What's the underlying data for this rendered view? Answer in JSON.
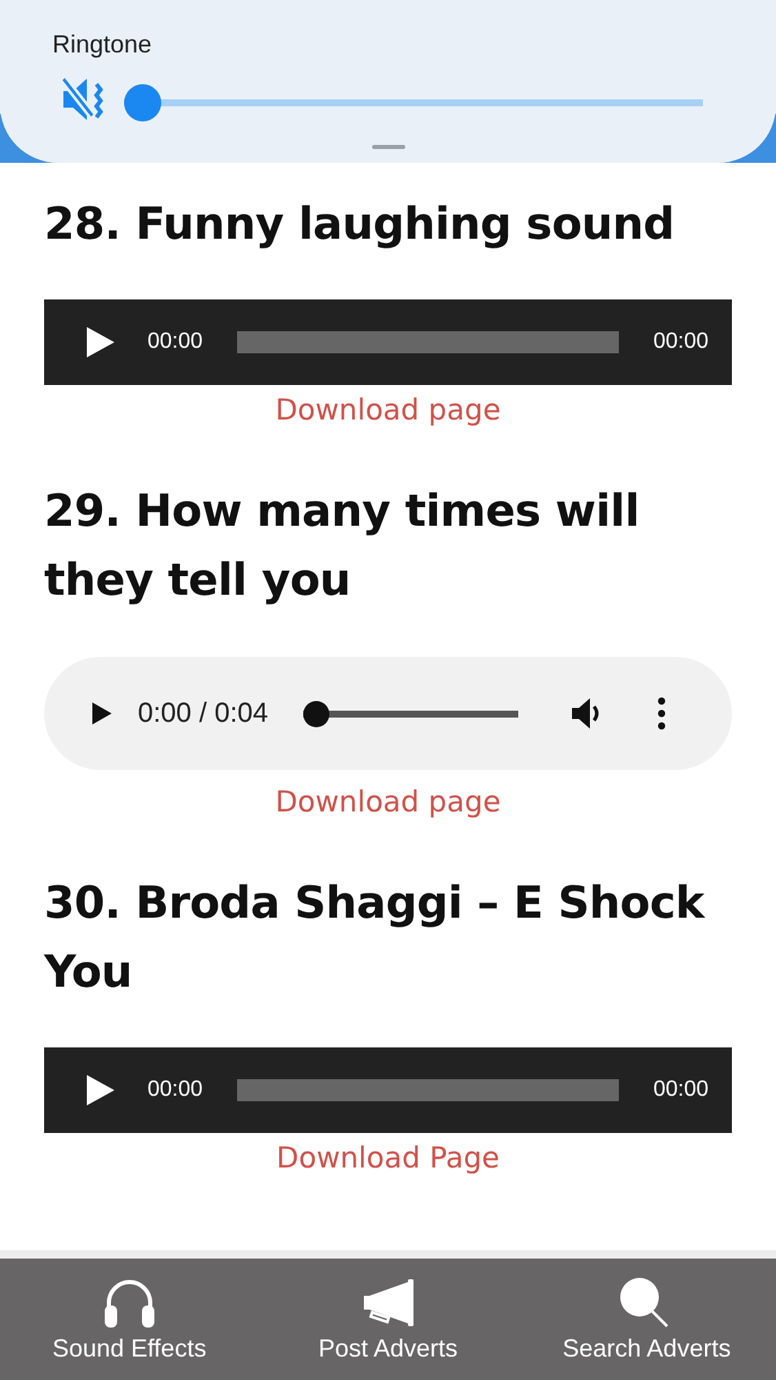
{
  "volume_panel": {
    "label": "Ringtone",
    "muted": true,
    "level": 0
  },
  "sounds": [
    {
      "title": "28. Funny laughing sound",
      "player": {
        "kind": "dark",
        "current": "00:00",
        "duration": "00:00"
      },
      "link": "Download page"
    },
    {
      "title": "29. How many times will they tell you",
      "player": {
        "kind": "light",
        "time": "0:00 / 0:04",
        "level": 0
      },
      "link": "Download page"
    },
    {
      "title": "30. Broda Shaggi – E Shock You",
      "player": {
        "kind": "dark",
        "current": "00:00",
        "duration": "00:00"
      },
      "link": "Download Page"
    }
  ],
  "bottom_nav": [
    {
      "label": "Sound Effects",
      "kind": "headphones"
    },
    {
      "label": "Post Adverts",
      "kind": "megaphone"
    },
    {
      "label": "Search Adverts",
      "kind": "search"
    }
  ]
}
